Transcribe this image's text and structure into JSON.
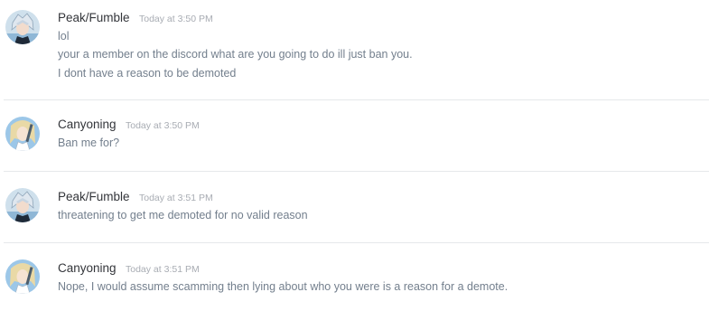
{
  "messages": [
    {
      "author": "Peak/Fumble",
      "timestamp": "Today at 3:50 PM",
      "avatar_icon": "anime-character-avatar-icon",
      "lines": [
        "lol",
        "your a member on the discord what are you going to do ill just ban you.",
        "I dont have a reason to be demoted"
      ]
    },
    {
      "author": "Canyoning",
      "timestamp": "Today at 3:50 PM",
      "avatar_icon": "anime-character-avatar-icon",
      "lines": [
        "Ban me for?"
      ]
    },
    {
      "author": "Peak/Fumble",
      "timestamp": "Today at 3:51 PM",
      "avatar_icon": "anime-character-avatar-icon",
      "lines": [
        "threatening to get me demoted for no valid reason"
      ]
    },
    {
      "author": "Canyoning",
      "timestamp": "Today at 3:51 PM",
      "avatar_icon": "anime-character-avatar-icon",
      "lines": [
        "Nope, I would assume scamming then lying about who you were is a reason for a demote."
      ]
    }
  ],
  "colors": {
    "background": "#ffffff",
    "username": "#33353a",
    "timestamp": "#a8acb3",
    "message_text": "#737f8d",
    "divider": "#e6e8eb"
  }
}
